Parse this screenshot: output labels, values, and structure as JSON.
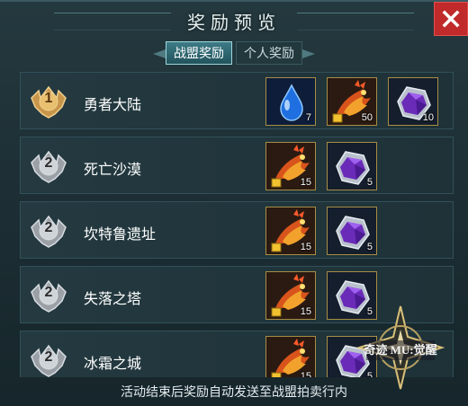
{
  "title": "奖励预览",
  "close_icon": "close-icon",
  "tabs": [
    {
      "label": "战盟奖励",
      "active": true
    },
    {
      "label": "个人奖励",
      "active": false
    }
  ],
  "rows": [
    {
      "rank": "1",
      "name": "勇者大陆",
      "rewards": [
        {
          "icon": "water-drop-icon",
          "qty": "7"
        },
        {
          "icon": "phoenix-icon",
          "qty": "50"
        },
        {
          "icon": "purple-gem-icon",
          "qty": "10"
        }
      ]
    },
    {
      "rank": "2",
      "name": "死亡沙漠",
      "rewards": [
        {
          "icon": "phoenix-icon",
          "qty": "15"
        },
        {
          "icon": "purple-gem-icon",
          "qty": "5"
        }
      ]
    },
    {
      "rank": "2",
      "name": "坎特鲁遗址",
      "rewards": [
        {
          "icon": "phoenix-icon",
          "qty": "15"
        },
        {
          "icon": "purple-gem-icon",
          "qty": "5"
        }
      ]
    },
    {
      "rank": "2",
      "name": "失落之塔",
      "rewards": [
        {
          "icon": "phoenix-icon",
          "qty": "15"
        },
        {
          "icon": "purple-gem-icon",
          "qty": "5"
        }
      ]
    },
    {
      "rank": "2",
      "name": "冰霜之城",
      "rewards": [
        {
          "icon": "phoenix-icon",
          "qty": "15"
        },
        {
          "icon": "purple-gem-icon",
          "qty": "5"
        }
      ]
    }
  ],
  "footer": "活动结束后奖励自动发送至战盟拍卖行内",
  "watermark": "奇迹 MU:觉醒",
  "colors": {
    "accent": "#3d7b86",
    "close": "#c12a2a",
    "item_border": "#a88d44"
  }
}
